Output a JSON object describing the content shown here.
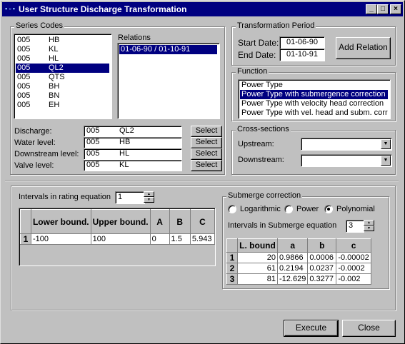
{
  "window": {
    "title": "User Structure Discharge Transformation"
  },
  "series_codes": {
    "label": "Series Codes",
    "items": [
      {
        "code": "005",
        "name": "HB"
      },
      {
        "code": "005",
        "name": "KL"
      },
      {
        "code": "005",
        "name": "HL"
      },
      {
        "code": "005",
        "name": "QL2"
      },
      {
        "code": "005",
        "name": "QTS"
      },
      {
        "code": "005",
        "name": "BH"
      },
      {
        "code": "005",
        "name": "BN"
      },
      {
        "code": "005",
        "name": "EH"
      }
    ],
    "selected_index": 3
  },
  "relations": {
    "label": "Relations",
    "items": [
      "01-06-90 / 01-10-91"
    ]
  },
  "assignments": [
    {
      "label": "Discharge:",
      "code": "005",
      "name": "QL2",
      "button": "Select"
    },
    {
      "label": "Water level:",
      "code": "005",
      "name": "HB",
      "button": "Select"
    },
    {
      "label": "Downstream level:",
      "code": "005",
      "name": "HL",
      "button": "Select"
    },
    {
      "label": "Valve level:",
      "code": "005",
      "name": "KL",
      "button": "Select"
    }
  ],
  "period": {
    "label": "Transformation Period",
    "start_label": "Start Date:",
    "start_value": "01-06-90",
    "end_label": "End Date:",
    "end_value": "01-10-91",
    "add_button": "Add Relation"
  },
  "function": {
    "label": "Function",
    "items": [
      "Power Type",
      "Power Type with submergence correction",
      "Power Type with velocity head correction",
      "Power Type with vel. head and subm. corr"
    ],
    "selected_index": 1
  },
  "cross_sections": {
    "label": "Cross-sections",
    "upstream_label": "Upstream:",
    "downstream_label": "Downstream:",
    "upstream_value": "",
    "downstream_value": ""
  },
  "rating": {
    "intervals_label": "Intervals in rating equation",
    "intervals_value": "1",
    "headers": [
      "Lower bound.",
      "Upper bound.",
      "A",
      "B",
      "C"
    ],
    "rows": [
      {
        "n": "1",
        "cells": [
          "-100",
          "100",
          "0",
          "1.5",
          "5.943"
        ]
      }
    ]
  },
  "submerge": {
    "label": "Submerge correction",
    "options": [
      "Logarithmic",
      "Power",
      "Polynomial"
    ],
    "selected_index": 2,
    "intervals_label": "Intervals in Submerge equation",
    "intervals_value": "3",
    "headers": [
      "L. bound",
      "a",
      "b",
      "c"
    ],
    "rows": [
      {
        "n": "1",
        "cells": [
          "20",
          "0.9866",
          "0.0006",
          "-0.00002"
        ]
      },
      {
        "n": "2",
        "cells": [
          "61",
          "0.2194",
          "0.0237",
          "-0.0002"
        ]
      },
      {
        "n": "3",
        "cells": [
          "81",
          "-12.629",
          "0.3277",
          "-0.002"
        ]
      }
    ]
  },
  "footer": {
    "execute": "Execute",
    "close": "Close"
  }
}
